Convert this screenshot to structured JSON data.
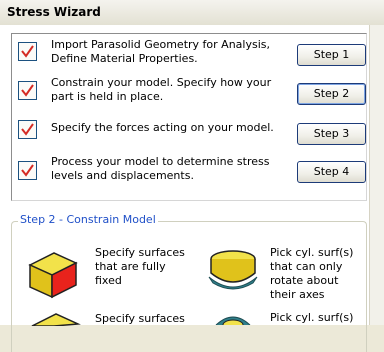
{
  "window": {
    "title": "Stress Wizard"
  },
  "steps": [
    {
      "description": "Import Parasolid Geometry for Analysis, Define Material Properties.",
      "button": "Step 1",
      "checked": true
    },
    {
      "description": "Constrain your model. Specify how your part is held in place.",
      "button": "Step 2",
      "checked": true
    },
    {
      "description": "Specify the forces acting on your model.",
      "button": "Step 3",
      "checked": true
    },
    {
      "description": "Process your model to determine stress levels and displacements.",
      "button": "Step 4",
      "checked": true
    }
  ],
  "constrain_group": {
    "label": "Step 2 - Constrain Model",
    "options": [
      {
        "text": "Specify surfaces that are fully fixed",
        "icon": "fixed-surface-icon"
      },
      {
        "text": "Pick cyl. surf(s) that can only rotate about their axes",
        "icon": "cylinder-rotate-icon"
      },
      {
        "text": "Specify surfaces",
        "icon": "surface-icon"
      },
      {
        "text": "Pick cyl. surf(s)",
        "icon": "cylinder-icon"
      }
    ]
  },
  "colors": {
    "check": "#d42b24",
    "button_border": "#1d3b78",
    "group_label": "#2050c8"
  }
}
